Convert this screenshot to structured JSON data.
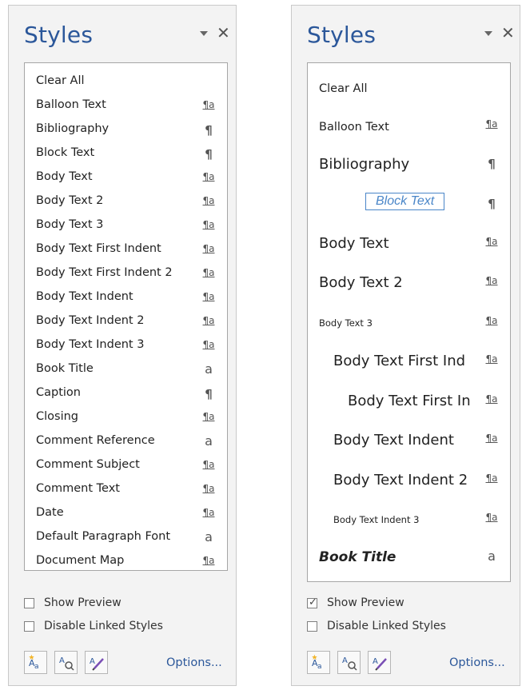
{
  "left_pane": {
    "title": "Styles",
    "styles": [
      {
        "label": "Clear All",
        "icon": ""
      },
      {
        "label": "Balloon Text",
        "icon": "linked"
      },
      {
        "label": "Bibliography",
        "icon": "para"
      },
      {
        "label": "Block Text",
        "icon": "para"
      },
      {
        "label": "Body Text",
        "icon": "linked"
      },
      {
        "label": "Body Text 2",
        "icon": "linked"
      },
      {
        "label": "Body Text 3",
        "icon": "linked"
      },
      {
        "label": "Body Text First Indent",
        "icon": "linked"
      },
      {
        "label": "Body Text First Indent 2",
        "icon": "linked"
      },
      {
        "label": "Body Text Indent",
        "icon": "linked"
      },
      {
        "label": "Body Text Indent 2",
        "icon": "linked"
      },
      {
        "label": "Body Text Indent 3",
        "icon": "linked"
      },
      {
        "label": "Book Title",
        "icon": "char"
      },
      {
        "label": "Caption",
        "icon": "para"
      },
      {
        "label": "Closing",
        "icon": "linked"
      },
      {
        "label": "Comment Reference",
        "icon": "char"
      },
      {
        "label": "Comment Subject",
        "icon": "linked"
      },
      {
        "label": "Comment Text",
        "icon": "linked"
      },
      {
        "label": "Date",
        "icon": "linked"
      },
      {
        "label": "Default Paragraph Font",
        "icon": "char"
      },
      {
        "label": "Document Map",
        "icon": "linked"
      }
    ],
    "show_preview": {
      "label": "Show Preview",
      "checked": false
    },
    "disable_linked": {
      "label": "Disable Linked Styles",
      "checked": false
    },
    "options_label": "Options..."
  },
  "right_pane": {
    "title": "Styles",
    "styles": [
      {
        "label": "Clear All",
        "icon": ""
      },
      {
        "label": "Balloon Text",
        "icon": "linked"
      },
      {
        "label": "Bibliography",
        "icon": "para"
      },
      {
        "label": "Block Text",
        "icon": "para",
        "selected": true
      },
      {
        "label": "Body Text",
        "icon": "linked"
      },
      {
        "label": "Body Text 2",
        "icon": "linked"
      },
      {
        "label": "Body Text 3",
        "icon": "linked"
      },
      {
        "label": "Body Text First Ind",
        "icon": "linked"
      },
      {
        "label": "Body Text First In",
        "icon": "linked"
      },
      {
        "label": "Body Text Indent",
        "icon": "linked"
      },
      {
        "label": "Body Text Indent 2",
        "icon": "linked"
      },
      {
        "label": "Body Text Indent 3",
        "icon": "linked"
      },
      {
        "label": "Book Title",
        "icon": "char"
      }
    ],
    "show_preview": {
      "label": "Show Preview",
      "checked": true
    },
    "disable_linked": {
      "label": "Disable Linked Styles",
      "checked": false
    },
    "options_label": "Options..."
  },
  "icons": {
    "linked": "¶a",
    "para": "¶",
    "char": "a",
    "close": "✕",
    "check": "✓"
  },
  "colors": {
    "title": "#2b579a",
    "link": "#2b579a",
    "selected_text": "#4a86c8",
    "selected_border": "#4a86c8"
  }
}
